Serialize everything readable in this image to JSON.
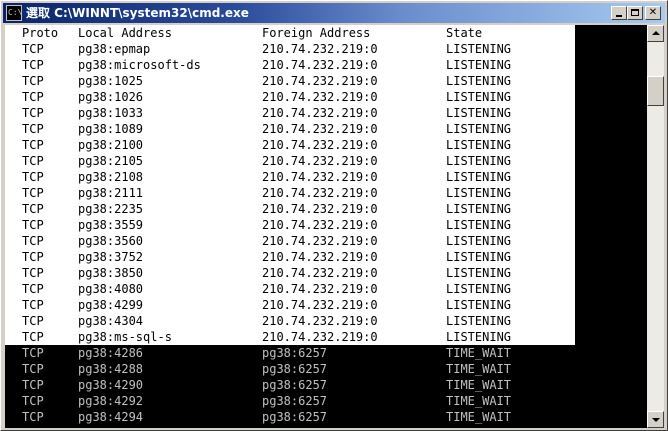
{
  "window": {
    "title": "選取 C:\\WINNT\\system32\\cmd.exe",
    "icon": "cmd-console-icon",
    "icon_glyph": "C:\\"
  },
  "table": {
    "headers": {
      "proto": "Proto",
      "local": "Local Address",
      "foreign": "Foreign Address",
      "state": "State"
    },
    "rows": [
      {
        "proto": "TCP",
        "local": "pg38:epmap",
        "foreign": "210.74.232.219:0",
        "state": "LISTENING"
      },
      {
        "proto": "TCP",
        "local": "pg38:microsoft-ds",
        "foreign": "210.74.232.219:0",
        "state": "LISTENING"
      },
      {
        "proto": "TCP",
        "local": "pg38:1025",
        "foreign": "210.74.232.219:0",
        "state": "LISTENING"
      },
      {
        "proto": "TCP",
        "local": "pg38:1026",
        "foreign": "210.74.232.219:0",
        "state": "LISTENING"
      },
      {
        "proto": "TCP",
        "local": "pg38:1033",
        "foreign": "210.74.232.219:0",
        "state": "LISTENING"
      },
      {
        "proto": "TCP",
        "local": "pg38:1089",
        "foreign": "210.74.232.219:0",
        "state": "LISTENING"
      },
      {
        "proto": "TCP",
        "local": "pg38:2100",
        "foreign": "210.74.232.219:0",
        "state": "LISTENING"
      },
      {
        "proto": "TCP",
        "local": "pg38:2105",
        "foreign": "210.74.232.219:0",
        "state": "LISTENING"
      },
      {
        "proto": "TCP",
        "local": "pg38:2108",
        "foreign": "210.74.232.219:0",
        "state": "LISTENING"
      },
      {
        "proto": "TCP",
        "local": "pg38:2111",
        "foreign": "210.74.232.219:0",
        "state": "LISTENING"
      },
      {
        "proto": "TCP",
        "local": "pg38:2235",
        "foreign": "210.74.232.219:0",
        "state": "LISTENING"
      },
      {
        "proto": "TCP",
        "local": "pg38:3559",
        "foreign": "210.74.232.219:0",
        "state": "LISTENING"
      },
      {
        "proto": "TCP",
        "local": "pg38:3560",
        "foreign": "210.74.232.219:0",
        "state": "LISTENING"
      },
      {
        "proto": "TCP",
        "local": "pg38:3752",
        "foreign": "210.74.232.219:0",
        "state": "LISTENING"
      },
      {
        "proto": "TCP",
        "local": "pg38:3850",
        "foreign": "210.74.232.219:0",
        "state": "LISTENING"
      },
      {
        "proto": "TCP",
        "local": "pg38:4080",
        "foreign": "210.74.232.219:0",
        "state": "LISTENING"
      },
      {
        "proto": "TCP",
        "local": "pg38:4299",
        "foreign": "210.74.232.219:0",
        "state": "LISTENING"
      },
      {
        "proto": "TCP",
        "local": "pg38:4304",
        "foreign": "210.74.232.219:0",
        "state": "LISTENING"
      },
      {
        "proto": "TCP",
        "local": "pg38:ms-sql-s",
        "foreign": "210.74.232.219:0",
        "state": "LISTENING"
      },
      {
        "proto": "TCP",
        "local": "pg38:4286",
        "foreign": "pg38:6257",
        "state": "TIME_WAIT"
      },
      {
        "proto": "TCP",
        "local": "pg38:4288",
        "foreign": "pg38:6257",
        "state": "TIME_WAIT"
      },
      {
        "proto": "TCP",
        "local": "pg38:4290",
        "foreign": "pg38:6257",
        "state": "TIME_WAIT"
      },
      {
        "proto": "TCP",
        "local": "pg38:4292",
        "foreign": "pg38:6257",
        "state": "TIME_WAIT"
      },
      {
        "proto": "TCP",
        "local": "pg38:4294",
        "foreign": "pg38:6257",
        "state": "TIME_WAIT"
      }
    ]
  },
  "selection": {
    "selected_rows_count": 19
  },
  "colors": {
    "selection_bg": "#ffffff",
    "selection_fg": "#000000",
    "console_bg": "#000000",
    "console_fg": "#c0c0c0",
    "titlebar_start": "#0a246a",
    "titlebar_end": "#a6caf0"
  },
  "scrollbar": {
    "position_fraction": 0.1
  }
}
